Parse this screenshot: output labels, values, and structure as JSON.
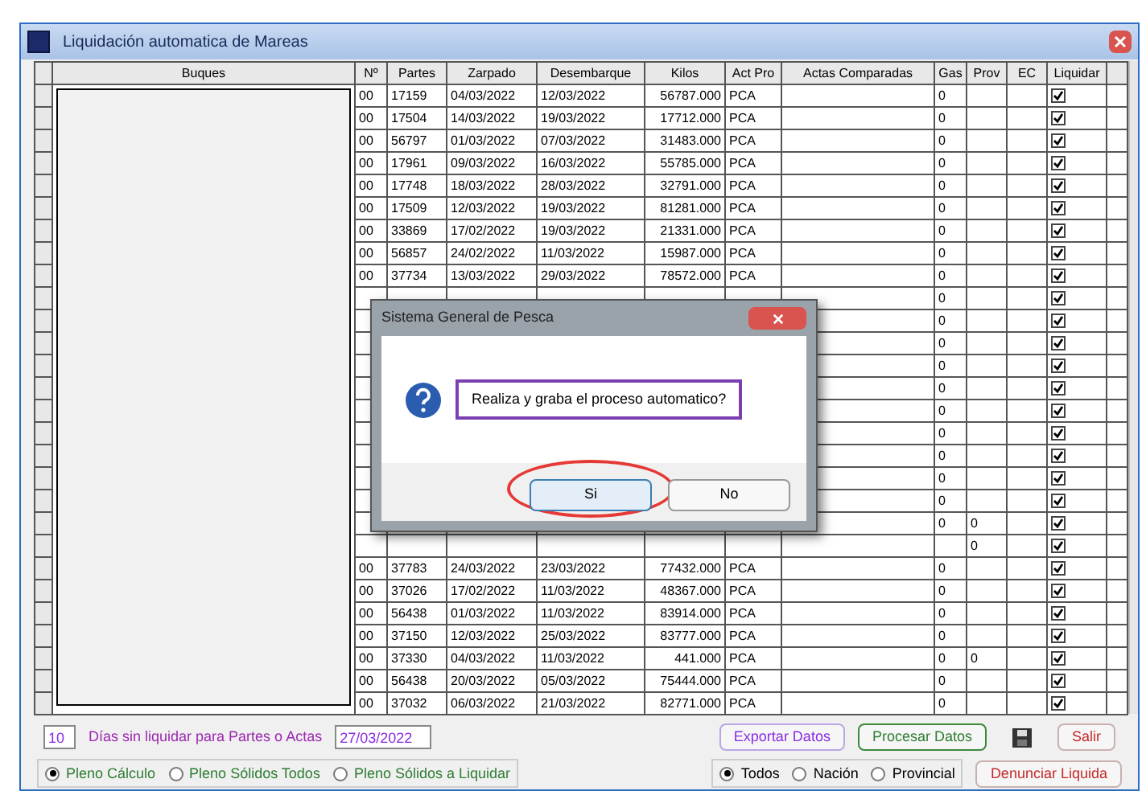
{
  "window": {
    "title": "Liquidación automatica de Mareas"
  },
  "table": {
    "columns": [
      "Buques",
      "Nº",
      "Partes",
      "Zarpado",
      "Desembarque",
      "Kilos",
      "Act Pro",
      "Actas Comparadas",
      "Gas",
      "Prov",
      "EC",
      "Liquidar"
    ],
    "rows": [
      {
        "n": "00",
        "partes": "17159",
        "zarpado": "04/03/2022",
        "desembarque": "12/03/2022",
        "kilos": "56787.000",
        "act_pro": "PCA",
        "gas": "0",
        "liquidar": true
      },
      {
        "n": "00",
        "partes": "17504",
        "zarpado": "14/03/2022",
        "desembarque": "19/03/2022",
        "kilos": "17712.000",
        "act_pro": "PCA",
        "gas": "0",
        "liquidar": true
      },
      {
        "n": "00",
        "partes": "56797",
        "zarpado": "01/03/2022",
        "desembarque": "07/03/2022",
        "kilos": "31483.000",
        "act_pro": "PCA",
        "gas": "0",
        "liquidar": true
      },
      {
        "n": "00",
        "partes": "17961",
        "zarpado": "09/03/2022",
        "desembarque": "16/03/2022",
        "kilos": "55785.000",
        "act_pro": "PCA",
        "gas": "0",
        "liquidar": true
      },
      {
        "n": "00",
        "partes": "17748",
        "zarpado": "18/03/2022",
        "desembarque": "28/03/2022",
        "kilos": "32791.000",
        "act_pro": "PCA",
        "gas": "0",
        "liquidar": true
      },
      {
        "n": "00",
        "partes": "17509",
        "zarpado": "12/03/2022",
        "desembarque": "19/03/2022",
        "kilos": "81281.000",
        "act_pro": "PCA",
        "gas": "0",
        "liquidar": true
      },
      {
        "n": "00",
        "partes": "33869",
        "zarpado": "17/02/2022",
        "desembarque": "19/03/2022",
        "kilos": "21331.000",
        "act_pro": "PCA",
        "gas": "0",
        "liquidar": true
      },
      {
        "n": "00",
        "partes": "56857",
        "zarpado": "24/02/2022",
        "desembarque": "11/03/2022",
        "kilos": "15987.000",
        "act_pro": "PCA",
        "gas": "0",
        "liquidar": true
      },
      {
        "n": "00",
        "partes": "37734",
        "zarpado": "13/03/2022",
        "desembarque": "29/03/2022",
        "kilos": "78572.000",
        "act_pro": "PCA",
        "gas": "0",
        "liquidar": true
      },
      {
        "gas": "0",
        "liquidar": true
      },
      {
        "gas": "0",
        "liquidar": true
      },
      {
        "gas": "0",
        "liquidar": true
      },
      {
        "gas": "0",
        "liquidar": true
      },
      {
        "gas": "0",
        "liquidar": true
      },
      {
        "gas": "0",
        "liquidar": true
      },
      {
        "gas": "0",
        "liquidar": true
      },
      {
        "gas": "0",
        "liquidar": true
      },
      {
        "gas": "0",
        "liquidar": true
      },
      {
        "gas": "0",
        "liquidar": true
      },
      {
        "gas": "0",
        "prov": "0",
        "liquidar": true
      },
      {
        "prov": "0",
        "liquidar": true
      },
      {
        "n": "00",
        "partes": "37783",
        "zarpado": "24/03/2022",
        "desembarque": "23/03/2022",
        "kilos": "77432.000",
        "act_pro": "PCA",
        "gas": "0",
        "liquidar": true
      },
      {
        "n": "00",
        "partes": "37026",
        "zarpado": "17/02/2022",
        "desembarque": "11/03/2022",
        "kilos": "48367.000",
        "act_pro": "PCA",
        "gas": "0",
        "liquidar": true
      },
      {
        "n": "00",
        "partes": "56438",
        "zarpado": "01/03/2022",
        "desembarque": "11/03/2022",
        "kilos": "83914.000",
        "act_pro": "PCA",
        "gas": "0",
        "liquidar": true
      },
      {
        "n": "00",
        "partes": "37150",
        "zarpado": "12/03/2022",
        "desembarque": "25/03/2022",
        "kilos": "83777.000",
        "act_pro": "PCA",
        "gas": "0",
        "liquidar": true
      },
      {
        "n": "00",
        "partes": "37330",
        "zarpado": "04/03/2022",
        "desembarque": "11/03/2022",
        "kilos": "441.000",
        "act_pro": "PCA",
        "gas": "0",
        "prov": "0",
        "liquidar": true
      },
      {
        "n": "00",
        "partes": "56438",
        "zarpado": "20/03/2022",
        "desembarque": "05/03/2022",
        "kilos": "75444.000",
        "act_pro": "PCA",
        "gas": "0",
        "liquidar": true
      },
      {
        "n": "00",
        "partes": "37032",
        "zarpado": "06/03/2022",
        "desembarque": "21/03/2022",
        "kilos": "82771.000",
        "act_pro": "PCA",
        "gas": "0",
        "liquidar": true
      }
    ]
  },
  "days_field": {
    "value": "10"
  },
  "days_label": "Días sin liquidar para Partes o Actas",
  "date_field": {
    "value": "27/03/2022"
  },
  "buttons": [
    {
      "label": "Exportar Datos",
      "kind": "export"
    },
    {
      "label": "Procesar Datos",
      "kind": "process"
    },
    {
      "label": "Salir",
      "kind": "exit"
    }
  ],
  "filter_radios": [
    {
      "label": "Pleno Cálculo",
      "selected": true
    },
    {
      "label": "Pleno Sólidos Todos",
      "selected": false
    },
    {
      "label": "Pleno Sólidos a Liquidar",
      "selected": false
    }
  ],
  "scope_radios": [
    {
      "label": "Todos",
      "selected": true
    },
    {
      "label": "Nación",
      "selected": false
    },
    {
      "label": "Provincial",
      "selected": false
    }
  ],
  "denounce_button": "Denunciar Liquida",
  "dialog": {
    "title": "Sistema General de Pesca",
    "message": "Realiza y graba el proceso automatico?",
    "buttons": [
      {
        "label": "Si",
        "highlighted": true
      },
      {
        "label": "No",
        "highlighted": false
      }
    ]
  }
}
